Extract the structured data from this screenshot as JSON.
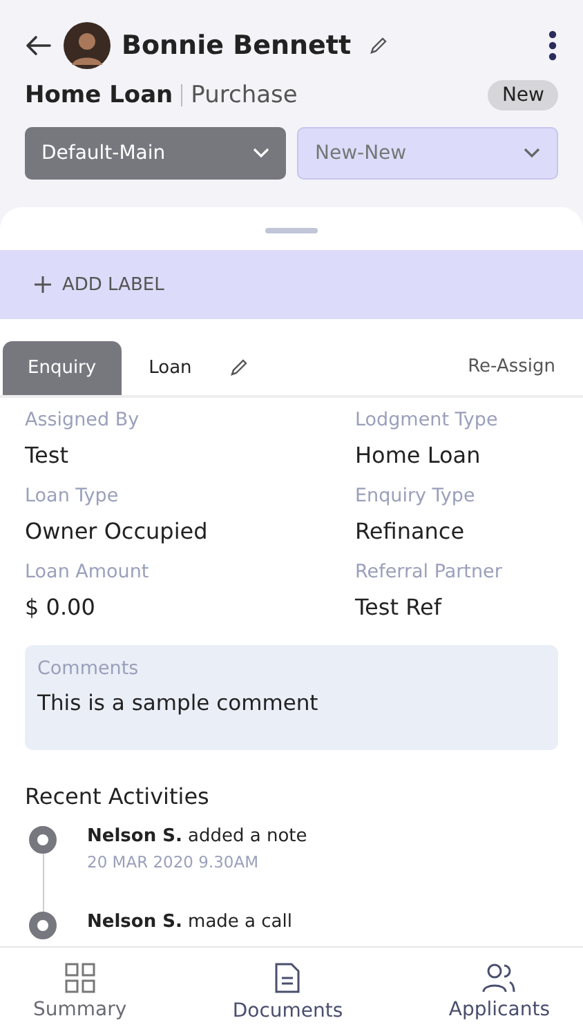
{
  "header": {
    "name": "Bonnie Bennett",
    "loan_title": "Home Loan",
    "loan_subtitle": "Purchase",
    "status": "New"
  },
  "dropdowns": [
    {
      "value": "Default-Main",
      "kind": "dark"
    },
    {
      "value": "New-New",
      "kind": "light"
    }
  ],
  "add_label": "ADD LABEL",
  "tabs": [
    {
      "label": "Enquiry",
      "selected": true,
      "editable": false
    },
    {
      "label": "Loan",
      "selected": false,
      "editable": true
    }
  ],
  "reassign": "Re-Assign",
  "fields": [
    {
      "label": "Assigned By",
      "value": "Test"
    },
    {
      "label": "Lodgment Type",
      "value": "Home Loan"
    },
    {
      "label": "Loan Type",
      "value": "Owner Occupied"
    },
    {
      "label": "Enquiry Type",
      "value": "Refinance"
    },
    {
      "label": "Loan Amount",
      "value": "$ 0.00"
    },
    {
      "label": "Referral Partner",
      "value": "Test Ref"
    }
  ],
  "comments": {
    "label": "Comments",
    "text": "This is a sample comment"
  },
  "activities_title": "Recent Activities",
  "activities": [
    {
      "text": "**Nelson S.** added a note",
      "time": "20 MAR 2020  9.30AM"
    },
    {
      "text": "**Nelson S.** made a call"
    }
  ],
  "nav": [
    {
      "label": "Summary",
      "kind": "grid"
    },
    {
      "label": "Documents",
      "kind": "document"
    },
    {
      "label": "Applicants",
      "kind": "people"
    }
  ]
}
